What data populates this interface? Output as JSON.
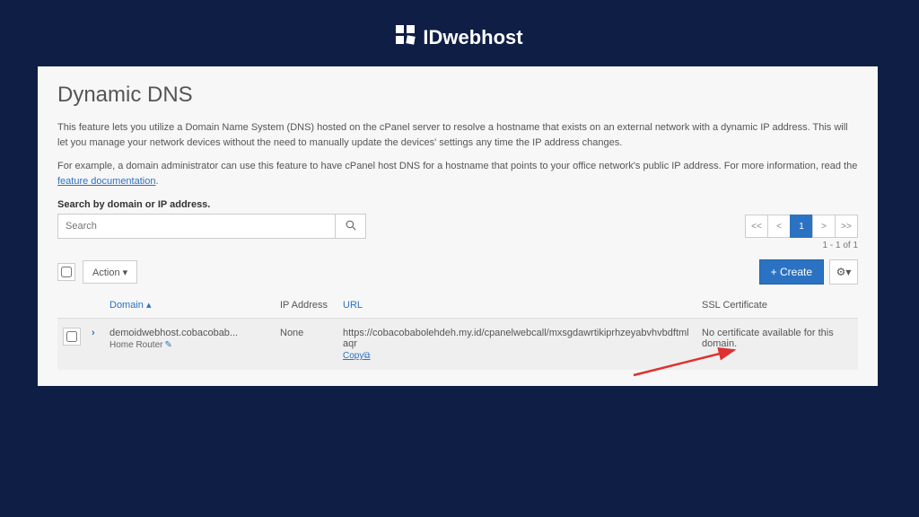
{
  "brand": {
    "name": "IDwebhost"
  },
  "page": {
    "title": "Dynamic DNS",
    "desc1": "This feature lets you utilize a Domain Name System (DNS) hosted on the cPanel server to resolve a hostname that exists on an external network with a dynamic IP address. This will let you manage your network devices without the need to manually update the devices' settings any time the IP address changes.",
    "desc2a": "For example, a domain administrator can use this feature to have cPanel host DNS for a hostname that points to your office network's public IP address. For more information, read the ",
    "desc2_link": "feature documentation",
    "desc2b": "."
  },
  "search": {
    "label": "Search by domain or IP address.",
    "placeholder": "Search"
  },
  "pagination": {
    "first": "<<",
    "prev": "<",
    "page1": "1",
    "next": ">",
    "last": ">>",
    "count": "1 - 1 of 1"
  },
  "toolbar": {
    "action_label": "Action ▾",
    "create_label": "+ Create",
    "gear_label": "⚙▾"
  },
  "table": {
    "headers": {
      "domain": "Domain ▴",
      "ip": "IP Address",
      "url": "URL",
      "ssl": "SSL Certificate"
    },
    "rows": [
      {
        "domain": "demoidwebhost.cobacobab...",
        "subdomain_label": "Home Router",
        "ip": "None",
        "url": "https://cobacobabolehdeh.my.id/cpanelwebcall/mxsgdawrtikiprhzeyabvhvbdftmlaqr",
        "copy_label": "Copy",
        "ssl": "No certificate available for this domain."
      }
    ]
  }
}
